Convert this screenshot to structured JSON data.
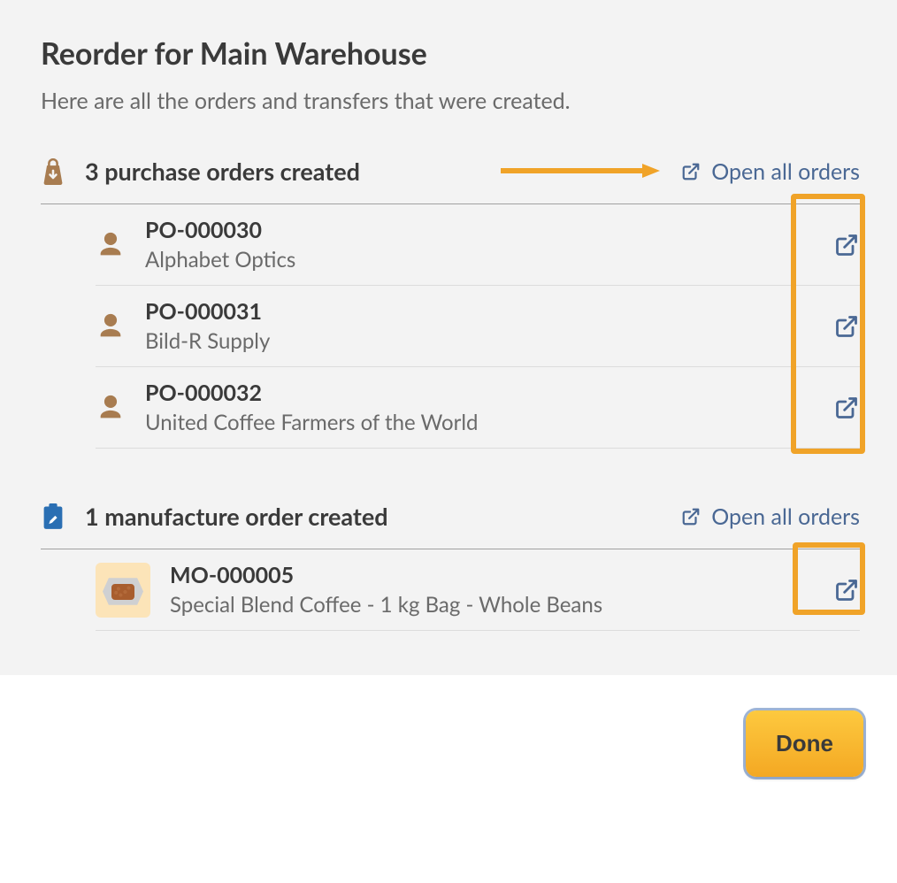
{
  "title": "Reorder for Main Warehouse",
  "subtitle": "Here are all the orders and transfers that were created.",
  "purchase_section": {
    "title": "3 purchase orders created",
    "open_all_label": "Open all orders",
    "orders": [
      {
        "id": "PO-000030",
        "vendor": "Alphabet Optics"
      },
      {
        "id": "PO-000031",
        "vendor": "Bild-R Supply"
      },
      {
        "id": "PO-000032",
        "vendor": "United Coffee Farmers of the World"
      }
    ]
  },
  "manufacture_section": {
    "title": "1 manufacture order created",
    "open_all_label": "Open all orders",
    "orders": [
      {
        "id": "MO-000005",
        "product": "Special Blend Coffee - 1 kg Bag - Whole Beans"
      }
    ]
  },
  "done_label": "Done"
}
